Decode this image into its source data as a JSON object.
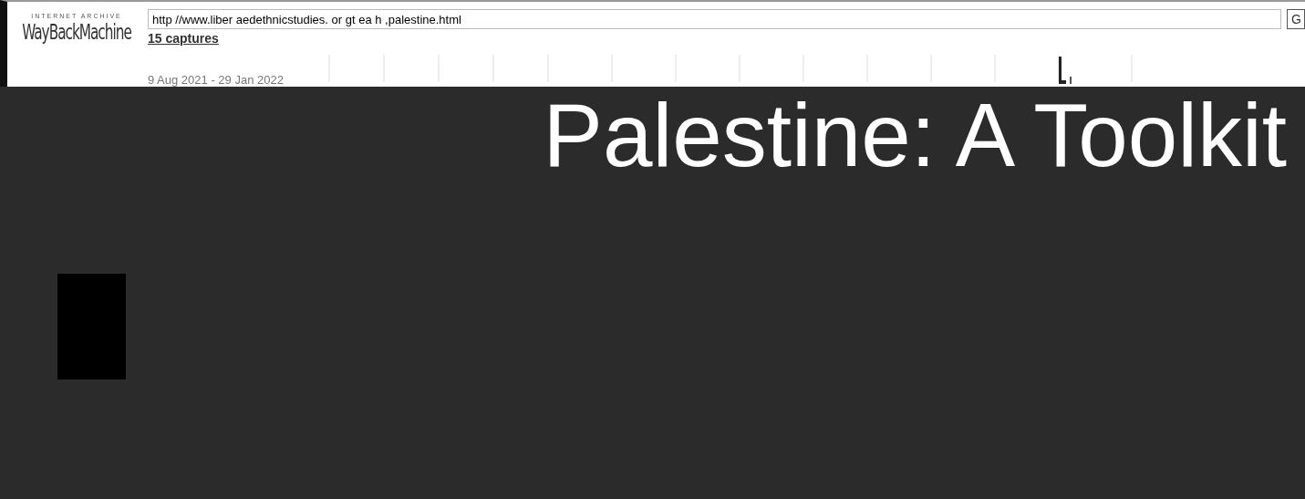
{
  "toolbar": {
    "logo_top": "INTERNET ARCHIVE",
    "logo": "WayBackMachine",
    "url": "http //www.liber aedethnicstudies. or gt ea h ,palestine.html",
    "go_button": "G",
    "captures": "15 captures",
    "date_range": "9 Aug 2021 - 29 Jan 2022"
  },
  "page": {
    "title": "Palestine: A Toolkit"
  }
}
